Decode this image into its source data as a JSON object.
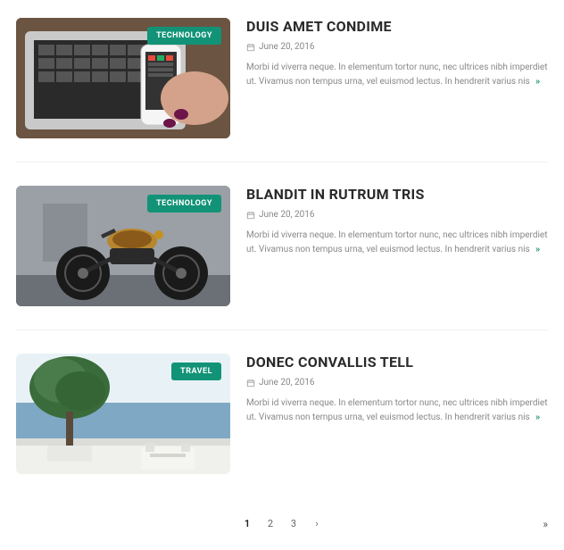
{
  "posts": [
    {
      "category": "TECHNOLOGY",
      "title": "DUIS AMET CONDIME",
      "date": "June 20, 2016",
      "excerpt": "Morbi id viverra neque. In elementum tortor nunc, nec ultrices nibh imperdiet ut. Vivamus non tempus urna, vel euismod lectus. In hendrerit varius nis"
    },
    {
      "category": "TECHNOLOGY",
      "title": "BLANDIT IN RUTRUM TRIS",
      "date": "June 20, 2016",
      "excerpt": "Morbi id viverra neque. In elementum tortor nunc, nec ultrices nibh imperdiet ut. Vivamus non tempus urna, vel euismod lectus. In hendrerit varius nis"
    },
    {
      "category": "TRAVEL",
      "title": "DONEC CONVALLIS TELL",
      "date": "June 20, 2016",
      "excerpt": "Morbi id viverra neque. In elementum tortor nunc, nec ultrices nibh imperdiet ut. Vivamus non tempus urna, vel euismod lectus. In hendrerit varius nis"
    }
  ],
  "pagination": {
    "pages": [
      "1",
      "2",
      "3"
    ],
    "current": 1,
    "next": "›",
    "last": "»"
  },
  "more_symbol": "»"
}
